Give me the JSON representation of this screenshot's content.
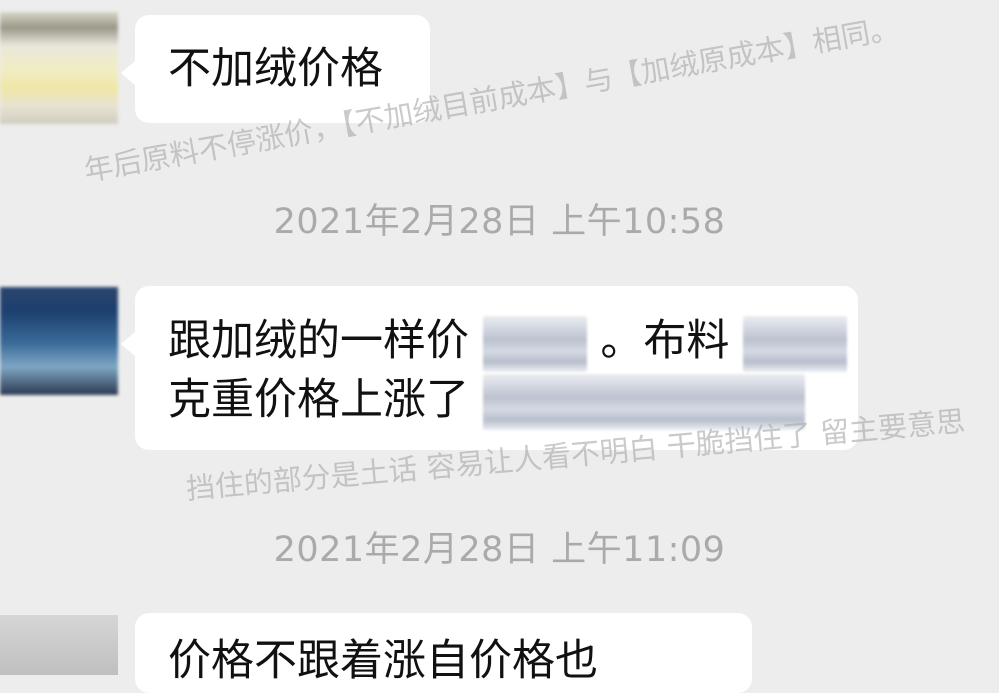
{
  "messages": [
    {
      "text": "不加绒价格"
    },
    {
      "line1_part1": "跟加绒的一样价",
      "line1_part2": "。布料",
      "line2_part1": "克重价格上涨了"
    },
    {
      "partial_text": "价格不跟着涨自价格也"
    }
  ],
  "timestamps": [
    "2021年2月28日 上午10:58",
    "2021年2月28日 上午11:09"
  ],
  "watermarks": [
    "年后原料不停涨价，【不加绒目前成本】与【加绒原成本】相同。",
    "挡住的部分是土话 容易让人看不明白 干脆挡住了 留主要意思"
  ]
}
